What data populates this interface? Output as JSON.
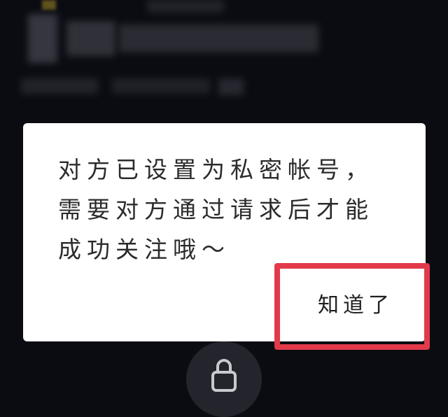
{
  "dialog": {
    "message_lines": [
      "对方已设置为私密帐号，",
      "需要对方通过请求后才能",
      "成功关注哦～"
    ],
    "confirm_label": "知道了"
  },
  "colors": {
    "background": "#0b0c12",
    "dialog": "#ffffff",
    "highlight": "#e23a4a"
  },
  "icons": {
    "bottom": "lock-icon"
  }
}
